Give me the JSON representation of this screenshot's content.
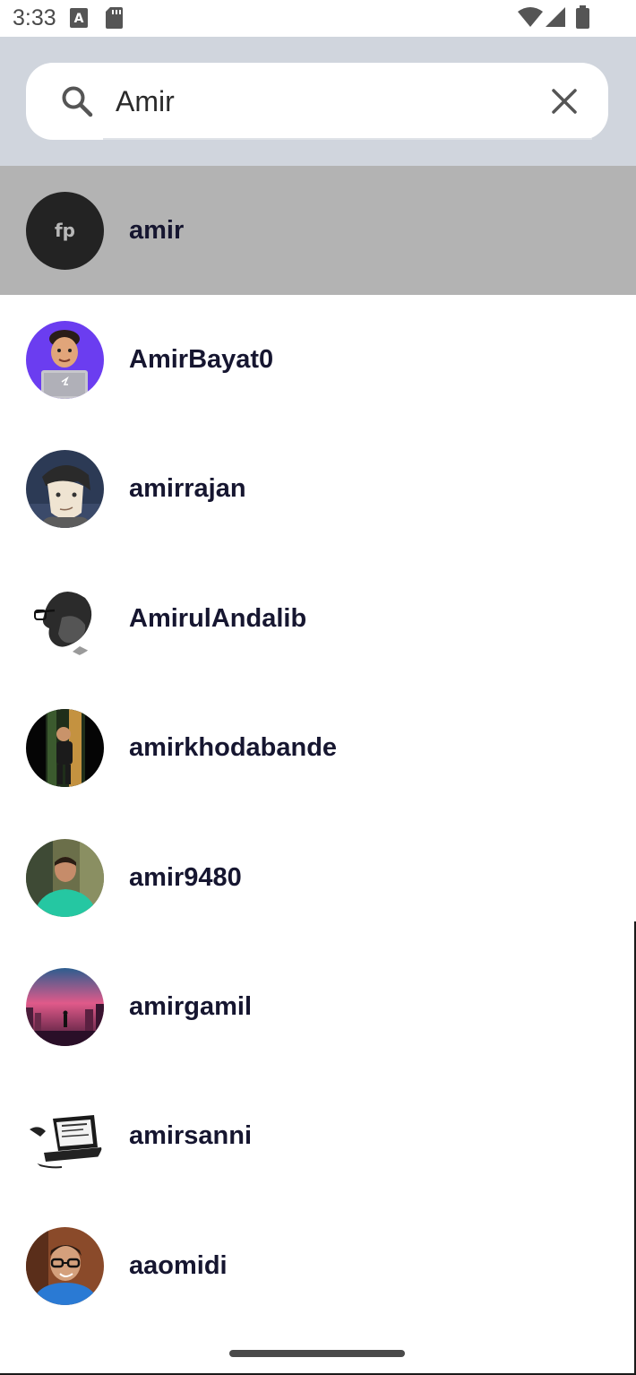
{
  "status_bar": {
    "time": "3:33",
    "icons": [
      "text-notification-icon",
      "sd-card-icon",
      "wifi-icon",
      "cell-signal-icon",
      "battery-icon"
    ]
  },
  "search": {
    "value": "Amir",
    "icon": "search-icon",
    "clear_icon": "close-icon"
  },
  "results": [
    {
      "username": "amir",
      "selected": true,
      "avatar": "fp-logo-avatar"
    },
    {
      "username": "AmirBayat0",
      "selected": false,
      "avatar": "memoji-laptop-avatar"
    },
    {
      "username": "amirrajan",
      "selected": false,
      "avatar": "illustrated-face-avatar"
    },
    {
      "username": "AmirulAndalib",
      "selected": false,
      "avatar": "bw-profile-avatar"
    },
    {
      "username": "amirkhodabande",
      "selected": false,
      "avatar": "forest-photo-avatar"
    },
    {
      "username": "amir9480",
      "selected": false,
      "avatar": "green-hoodie-avatar"
    },
    {
      "username": "amirgamil",
      "selected": false,
      "avatar": "neon-city-avatar"
    },
    {
      "username": "amirsanni",
      "selected": false,
      "avatar": "laptop-sketch-avatar"
    },
    {
      "username": "aaomidi",
      "selected": false,
      "avatar": "glasses-portrait-avatar"
    }
  ],
  "colors": {
    "header_bg": "#d0d5dd",
    "selected_row_bg": "#b3b3b3",
    "username_text": "#161630"
  }
}
